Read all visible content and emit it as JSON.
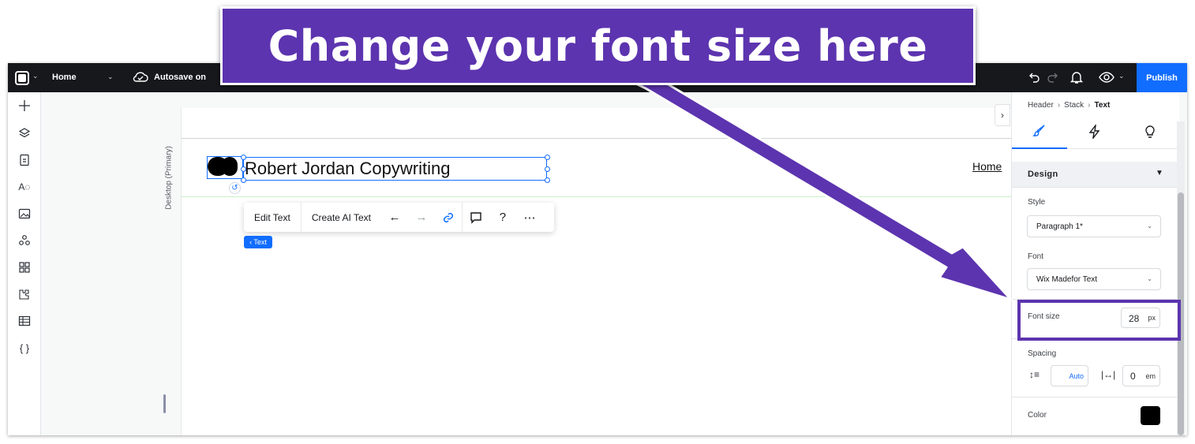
{
  "callout": {
    "text": "Change your font size here"
  },
  "topbar": {
    "page_name": "Home",
    "autosave": "Autosave on",
    "publish": "Publish"
  },
  "leftbar": {
    "icons": [
      "add-icon",
      "layers-icon",
      "pages-icon",
      "typography-icon",
      "media-icon",
      "apps-icon",
      "grid-icon",
      "puzzle-icon",
      "table-icon",
      "code-icon"
    ]
  },
  "canvas": {
    "breakpoint": "Desktop (Primary)",
    "site_title": "Robert Jordan Copywriting",
    "nav_link": "Home",
    "context_toolbar": {
      "edit_text": "Edit Text",
      "create_ai_text": "Create AI Text"
    },
    "selection_tag": "‹ Text"
  },
  "inspector": {
    "breadcrumb": [
      "Header",
      "Stack",
      "Text"
    ],
    "section": "Design",
    "style": {
      "label": "Style",
      "value": "Paragraph 1*"
    },
    "font": {
      "label": "Font",
      "value": "Wix Madefor Text"
    },
    "font_size": {
      "label": "Font size",
      "value": "28",
      "unit": "px"
    },
    "spacing": {
      "label": "Spacing",
      "line_height": "Auto",
      "letter_spacing": "0",
      "letter_unit": "em"
    },
    "color": {
      "label": "Color",
      "value": "#000000"
    }
  },
  "colors": {
    "accent": "#116dff",
    "callout": "#5c34af",
    "topbar": "#16181c"
  }
}
